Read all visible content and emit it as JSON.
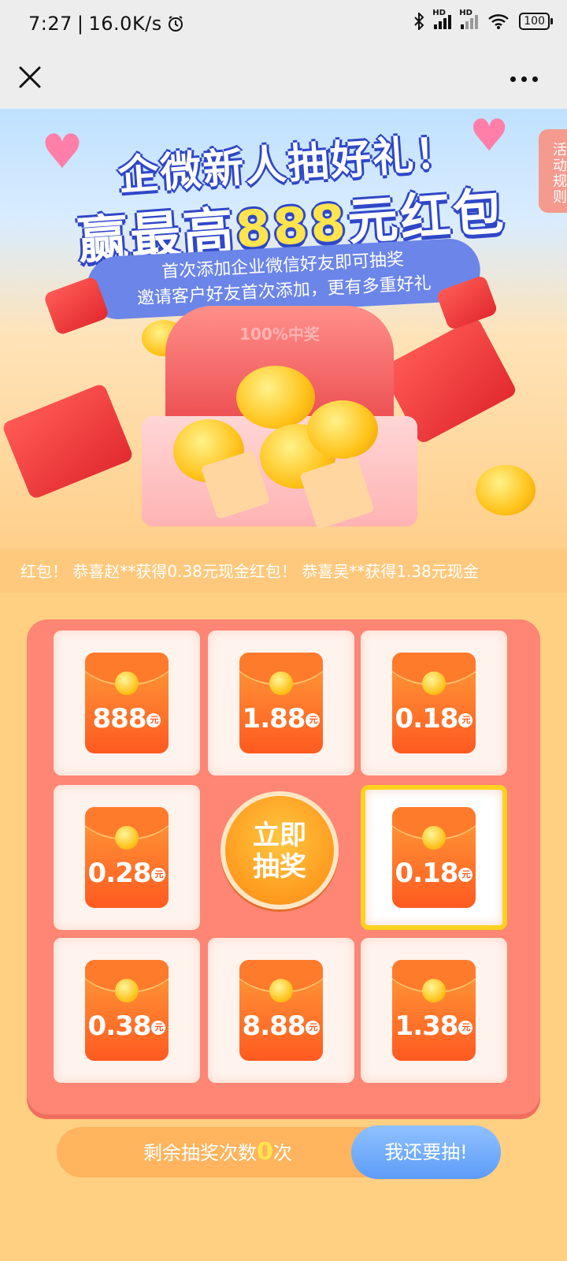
{
  "status_bar": {
    "time": "7:27",
    "speed": "16.0K/s",
    "battery": "100"
  },
  "banner": {
    "title_line1": "企微新人抽好礼！",
    "title_line2_prefix": "赢最高",
    "title_line2_highlight": "888",
    "title_line2_suffix": "元红包",
    "subtitle_line1": "首次添加企业微信好友即可抽奖",
    "subtitle_line2": "邀请客户好友首次添加，更有多重好礼",
    "rules_tab": "活动规则",
    "prize_label": "100%中奖"
  },
  "ticker": {
    "text": "红包！ 恭喜赵**获得0.38元现金红包！ 恭喜吴**获得1.38元现金"
  },
  "grid": {
    "cells": [
      {
        "amount": "888"
      },
      {
        "amount": "1.88"
      },
      {
        "amount": "0.18"
      },
      {
        "amount": "0.28"
      },
      {
        "amount": "0.18"
      },
      {
        "amount": "0.38"
      },
      {
        "amount": "8.88"
      },
      {
        "amount": "1.38"
      }
    ],
    "yuan_label": "元",
    "active_cell": "0.18",
    "draw_button_line1": "立即",
    "draw_button_line2": "抽奖"
  },
  "footer": {
    "remaining_prefix": "剩余抽奖次数",
    "remaining_count": "0",
    "remaining_suffix": "次",
    "again_button": "我还要抽!"
  },
  "colors": {
    "board": "#ff8574",
    "accent_yellow": "#ffd21f",
    "button_blue": "#5d9cf8"
  }
}
